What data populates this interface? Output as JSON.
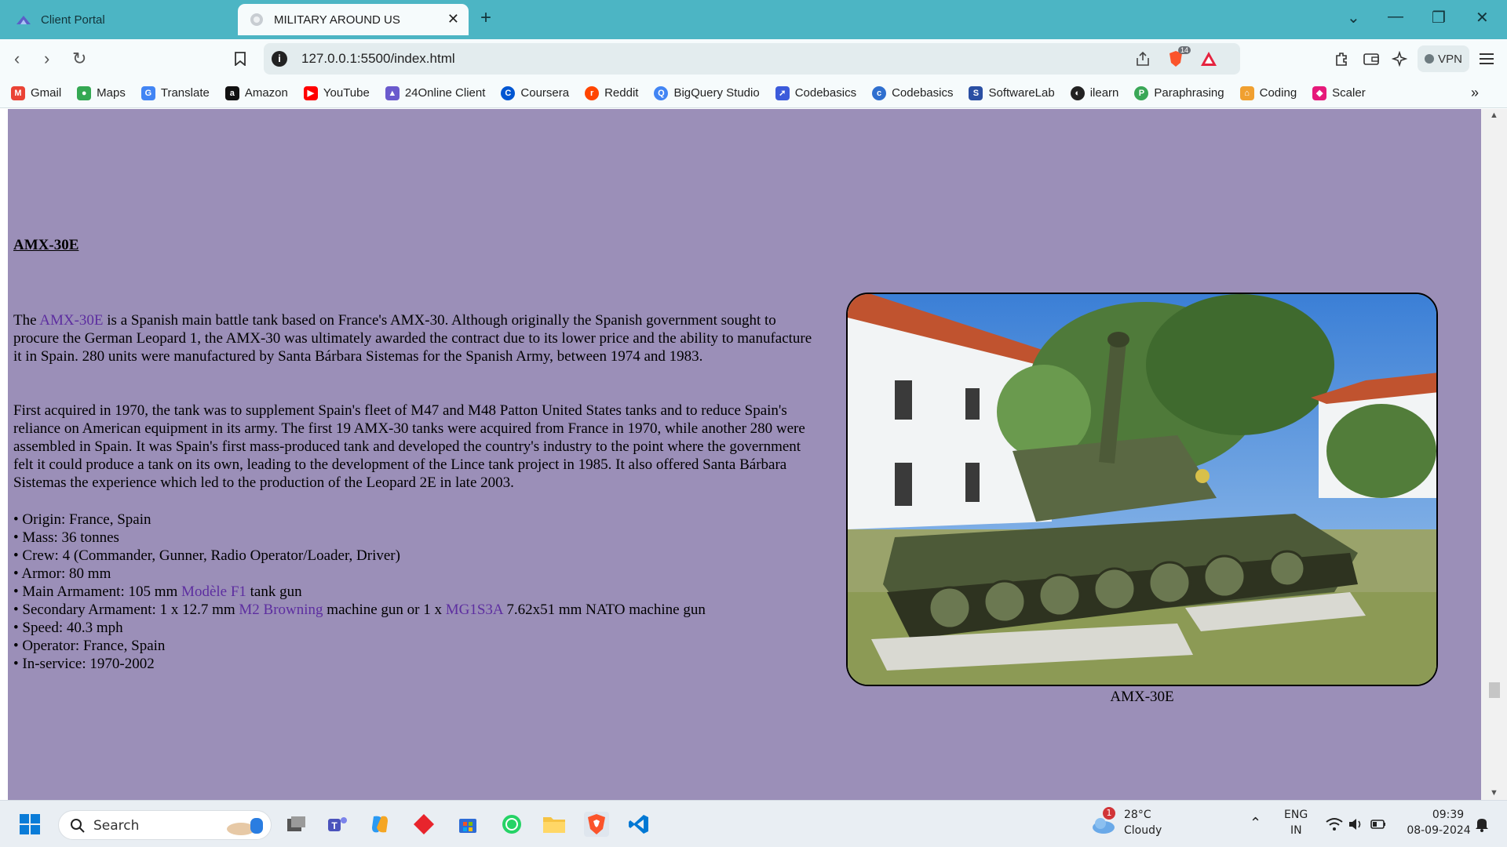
{
  "browser": {
    "tabs": [
      {
        "label": "Client Portal",
        "active": false
      },
      {
        "label": "MILITARY AROUND US",
        "active": true
      }
    ],
    "url": "127.0.0.1:5500/index.html",
    "vpn_label": "VPN",
    "shield_badge": "14",
    "bookmarks": [
      {
        "label": "Gmail",
        "icon": "gmail-icon",
        "color": "#ea4335"
      },
      {
        "label": "Maps",
        "icon": "maps-icon",
        "color": "#34a853"
      },
      {
        "label": "Translate",
        "icon": "translate-icon",
        "color": "#4285f4"
      },
      {
        "label": "Amazon",
        "icon": "amazon-icon",
        "color": "#111111"
      },
      {
        "label": "YouTube",
        "icon": "youtube-icon",
        "color": "#ff0000"
      },
      {
        "label": "24Online Client",
        "icon": "24online-icon",
        "color": "#6a5acd"
      },
      {
        "label": "Coursera",
        "icon": "coursera-icon",
        "color": "#0056d2"
      },
      {
        "label": "Reddit",
        "icon": "reddit-icon",
        "color": "#ff4500"
      },
      {
        "label": "BigQuery Studio",
        "icon": "bigquery-icon",
        "color": "#4285f4"
      },
      {
        "label": "Codebasics",
        "icon": "codebasics-icon",
        "color": "#3b5bdb"
      },
      {
        "label": "Codebasics",
        "icon": "codebasics-icon",
        "color": "#2f6fcf"
      },
      {
        "label": "SoftwareLab",
        "icon": "softwarelab-icon",
        "color": "#2a4fa3"
      },
      {
        "label": "ilearn",
        "icon": "ilearn-icon",
        "color": "#222222"
      },
      {
        "label": "Paraphrasing",
        "icon": "paraphrasing-icon",
        "color": "#3aa757"
      },
      {
        "label": "Coding",
        "icon": "coding-icon",
        "color": "#f0a030"
      },
      {
        "label": "Scaler",
        "icon": "scaler-icon",
        "color": "#e6197a"
      }
    ]
  },
  "article": {
    "title": "AMX-30E",
    "p1": {
      "before": "The ",
      "link": "AMX-30E",
      "after": " is a Spanish main battle tank based on France's AMX-30. Although originally the Spanish government sought to procure the German Leopard 1, the AMX-30 was ultimately awarded the contract due to its lower price and the ability to manufacture it in Spain. 280 units were manufactured by Santa Bárbara Sistemas for the Spanish Army, between 1974 and 1983."
    },
    "p2": "First acquired in 1970, the tank was to supplement Spain's fleet of M47 and M48 Patton United States tanks and to reduce Spain's reliance on American equipment in its army. The first 19 AMX-30 tanks were acquired from France in 1970, while another 280 were assembled in Spain. It was Spain's first mass-produced tank and developed the country's industry to the point where the government felt it could produce a tank on its own, leading to the development of the Lince tank project in 1985. It also offered Santa Bárbara Sistemas the experience which led to the production of the Leopard 2E in late 2003.",
    "specs": {
      "origin": "• Origin: France, Spain",
      "mass": "• Mass: 36 tonnes",
      "crew": "• Crew: 4 (Commander, Gunner, Radio Operator/Loader, Driver)",
      "armor": "• Armor: 80 mm",
      "main_armament_before": "• Main Armament: 105 mm ",
      "main_armament_link": "Modèle F1",
      "main_armament_after": " tank gun",
      "secondary_before": "• Secondary Armament: 1 x 12.7 mm ",
      "secondary_link1": "M2 Browning",
      "secondary_mid": " machine gun or 1 x ",
      "secondary_link2": "MG1S3A",
      "secondary_after": " 7.62x51 mm NATO machine gun",
      "speed": "• Speed: 40.3 mph",
      "operator": "• Operator: France, Spain",
      "in_service": "• In-service: 1970-2002"
    },
    "image_caption": "AMX-30E",
    "background_color": "#9b8fb8",
    "link_color": "#5d2ea0"
  },
  "taskbar": {
    "search_label": "Search",
    "weather_temp": "28°C",
    "weather_desc": "Cloudy",
    "weather_badge": "1",
    "language_line1": "ENG",
    "language_line2": "IN",
    "time": "09:39",
    "date": "08-09-2024"
  }
}
